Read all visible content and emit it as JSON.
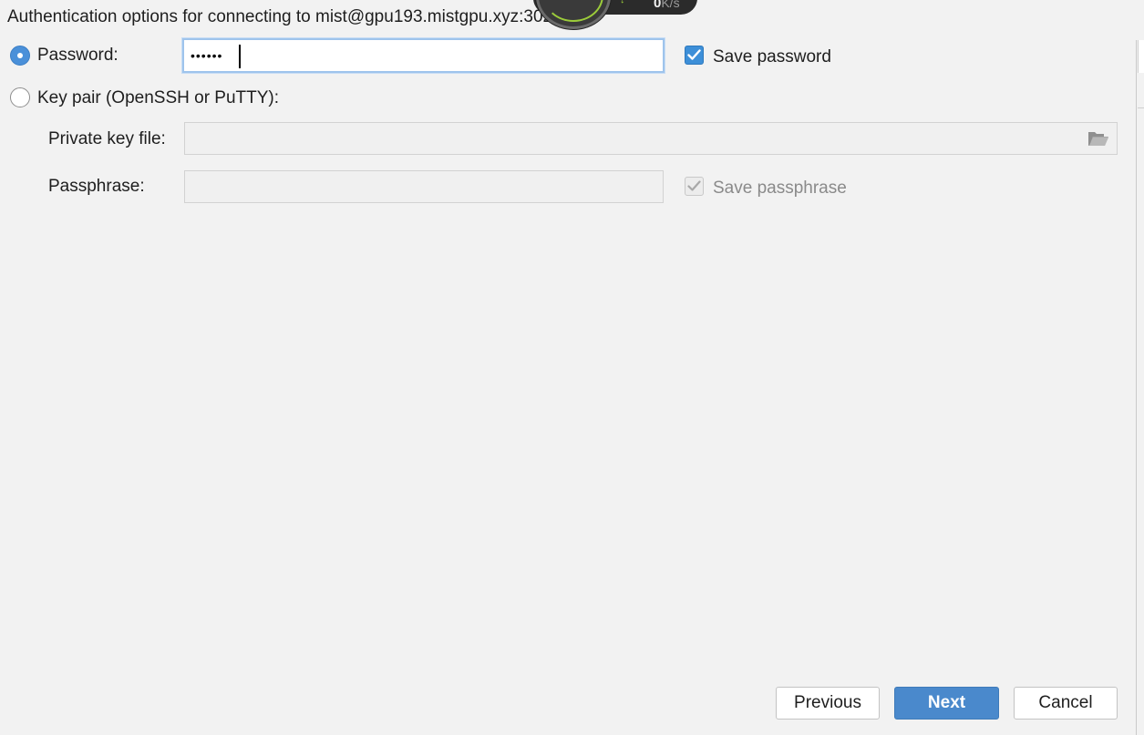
{
  "dialog": {
    "heading": "Authentication options for connecting to mist@gpu193.mistgpu.xyz:30220"
  },
  "password_option": {
    "label": "Password:",
    "selected": true,
    "masked_value": "••••••",
    "save_label": "Save password",
    "save_checked": true
  },
  "keypair_option": {
    "label": "Key pair (OpenSSH or PuTTY):",
    "selected": false,
    "private_key_label": "Private key file:",
    "private_key_value": "",
    "passphrase_label": "Passphrase:",
    "passphrase_value": "",
    "save_passphrase_label": "Save passphrase",
    "save_passphrase_checked": true
  },
  "footer": {
    "previous_label": "Previous",
    "next_label": "Next",
    "cancel_label": "Cancel"
  },
  "net_widget": {
    "speed_value": "0",
    "speed_unit": "K/s"
  },
  "icons": {
    "browse": "folder-open-icon",
    "check": "checkmark-icon"
  },
  "colors": {
    "accent": "#4a89cc",
    "background": "#f2f2f2"
  }
}
